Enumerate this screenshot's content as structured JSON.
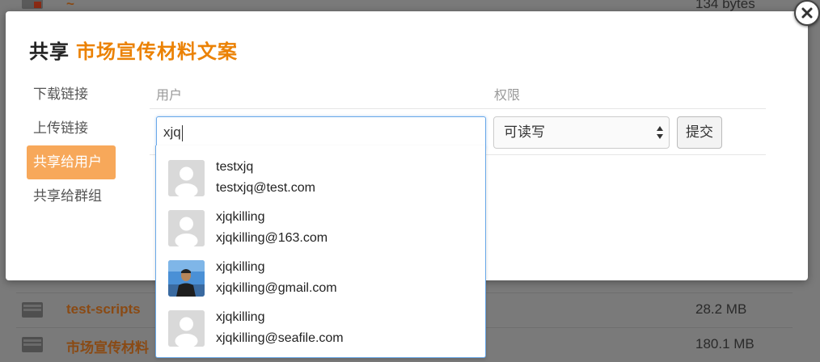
{
  "background": {
    "top_partial_size": "134 bytes",
    "rows": [
      {
        "name": "test-scripts",
        "size": "28.2 MB"
      },
      {
        "name": "市场宣传材料",
        "size": "180.1 MB"
      }
    ]
  },
  "modal": {
    "title_prefix": "共享",
    "item_name": "市场宣传材料文案",
    "nav": [
      {
        "label": "下载链接"
      },
      {
        "label": "上传链接"
      },
      {
        "label": "共享给用户"
      },
      {
        "label": "共享给群组"
      }
    ],
    "columns": {
      "user": "用户",
      "permission": "权限"
    },
    "user_input": {
      "value": "xjq"
    },
    "permission_select": {
      "selected": "可读写"
    },
    "submit_label": "提交",
    "suggestions": [
      {
        "username": "testxjq",
        "email": "testxjq@test.com",
        "avatar": "default-avatar"
      },
      {
        "username": "xjqkilling",
        "email": "xjqkilling@163.com",
        "avatar": "default-avatar"
      },
      {
        "username": "xjqkilling",
        "email": "xjqkilling@gmail.com",
        "avatar": "photo-avatar"
      },
      {
        "username": "xjqkilling",
        "email": "xjqkilling@seafile.com",
        "avatar": "default-avatar"
      }
    ]
  },
  "colors": {
    "accent": "#eb8205",
    "nav_active_bg": "#f7a85a",
    "input_focus_border": "#6aa9e9"
  }
}
